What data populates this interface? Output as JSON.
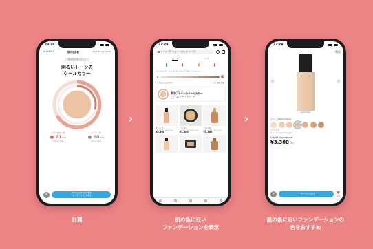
{
  "captions": {
    "step1": "計測",
    "step2_line1": "肌の色に近い",
    "step2_line2": "ファンデーションを表示",
    "step3_line1": "肌の色に近いファンデーションの",
    "step3_line2": "色をおすすめ"
  },
  "arrows": [
    "›",
    "›"
  ],
  "phone1": {
    "time": "23:29",
    "header": {
      "left": "NG MAOS",
      "center": "肌の色診断",
      "right": "2021.07.21 12:00"
    },
    "pill": "肌の色を分析しました",
    "title_line1": "明るいトーンの",
    "title_line2": "クールカラー",
    "measurement_1": {
      "label": "ヘモグロビン値",
      "value": "71",
      "unit": "/100",
      "sub": "平均より高め"
    },
    "measurement_2": {
      "label": "メラニン値",
      "value": "60",
      "unit": "/100",
      "sub": "平均より低め"
    },
    "close_icon": "close-icon",
    "button_line1": "あなたに似合うおすすめ",
    "button_line2": "ファンデーションを見る"
  },
  "phone2": {
    "time": "23:29",
    "search_text": "A ファンデーション・リキッドファンデ",
    "tabs": [
      "ベース",
      "メイク"
    ],
    "chips": "ファンデーション  リキッド  クッション  パウダー  コンシーラー",
    "toggle_left": "あなたへのおすすめ",
    "toggle_right": "並び順を変更",
    "reco_small": "あなたに近い色",
    "reco_big": "明るいトーンのクールカラー",
    "reco_sub": "ヘモグロビン 71 メラニン 60",
    "products": [
      {
        "brand": "ブランド名",
        "name": "リキッドファンデーション",
        "price": "¥3,300"
      },
      {
        "brand": "ブランド名",
        "name": "クッションファンデーション",
        "price": "¥3,300"
      },
      {
        "brand": "ブランド名",
        "name": "リキッドファンデーション",
        "price": "¥3,300"
      }
    ]
  },
  "phone3": {
    "time": "23:29",
    "close_label": "閉じる",
    "shade_label": "カラー: 01 Natural Beige",
    "brand": "ブランド名",
    "category": "リキッドファンデーション",
    "product_name": "Liquid Foundation",
    "price": "¥3,300",
    "tax": "税込",
    "cart_label": "カートに入れる",
    "likes": "1234",
    "swatch_colors": [
      "#f4dcc6",
      "#efd0b4",
      "#ecc9ad",
      "#e6bd9c",
      "#ddb08c",
      "#d6a37e",
      "#c8936b"
    ]
  },
  "colors": {
    "background": "#ec8385",
    "accent_blue": "#36a6e0",
    "coral": "#e26c5e"
  }
}
